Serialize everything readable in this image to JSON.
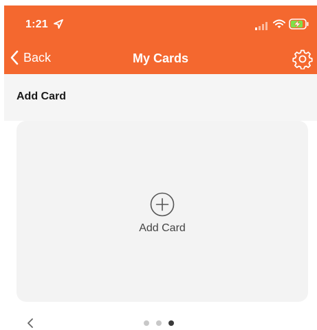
{
  "status_bar": {
    "time": "1:21",
    "location_icon": "location-arrow-icon",
    "signal_icon": "cellular-signal-icon",
    "wifi_icon": "wifi-icon",
    "battery_icon": "battery-charging-icon"
  },
  "nav": {
    "back_label": "Back",
    "title": "My Cards",
    "settings_icon": "gear-icon"
  },
  "section": {
    "title": "Add Card"
  },
  "add_card": {
    "label": "Add Card",
    "icon": "plus-circle-icon"
  },
  "pager": {
    "prev_icon": "chevron-left-icon",
    "page_count": 3,
    "current_page": 3
  },
  "colors": {
    "brand": "#f4682f",
    "section_bg": "#f5f5f5",
    "panel_bg": "#f3f3f3",
    "dot_inactive": "#c8c8c8",
    "dot_active": "#3a3a3a"
  }
}
